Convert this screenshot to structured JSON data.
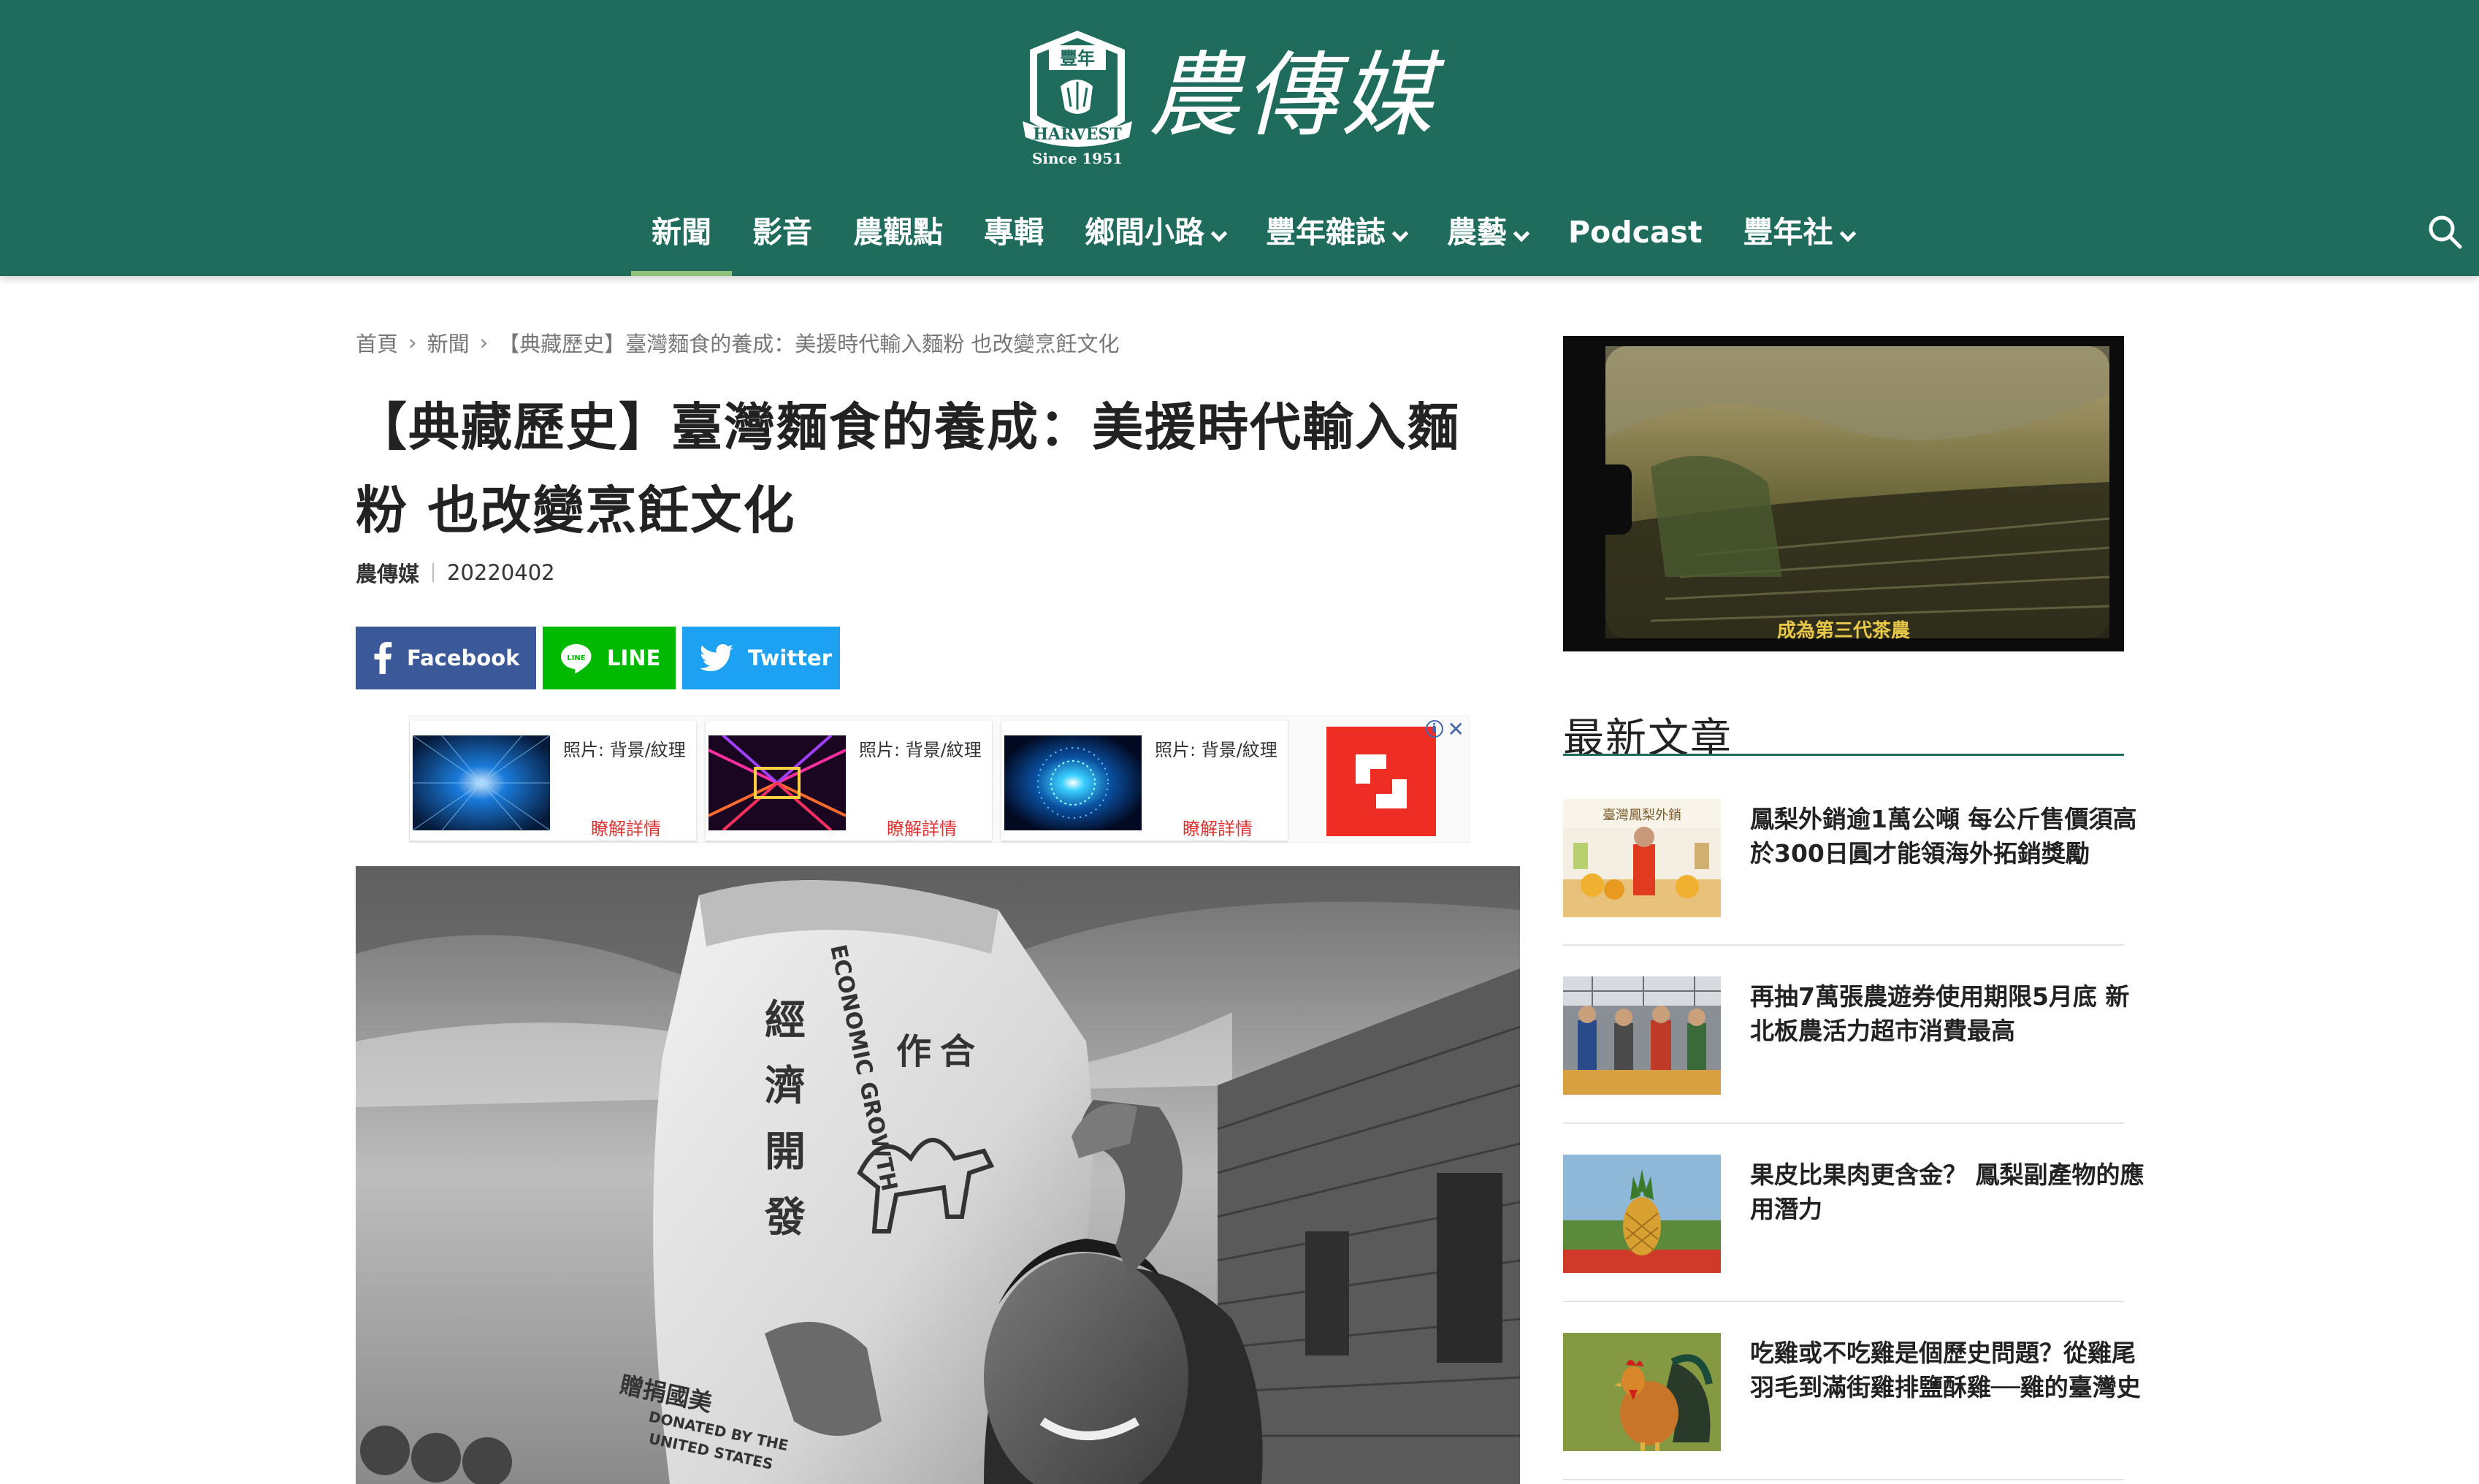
{
  "brand": {
    "emblem_top": "豐年",
    "emblem_band": "HARVEST",
    "emblem_since": "Since 1951",
    "name": "農傳媒"
  },
  "nav": {
    "items": [
      {
        "label": "新聞",
        "active": true,
        "dropdown": false
      },
      {
        "label": "影音",
        "active": false,
        "dropdown": false
      },
      {
        "label": "農觀點",
        "active": false,
        "dropdown": false
      },
      {
        "label": "專輯",
        "active": false,
        "dropdown": false
      },
      {
        "label": "鄉間小路",
        "active": false,
        "dropdown": true
      },
      {
        "label": "豐年雜誌",
        "active": false,
        "dropdown": true
      },
      {
        "label": "農藝",
        "active": false,
        "dropdown": true
      },
      {
        "label": "Podcast",
        "active": false,
        "dropdown": false
      },
      {
        "label": "豐年社",
        "active": false,
        "dropdown": true
      }
    ],
    "search_icon": "search-icon"
  },
  "breadcrumb": {
    "home": "首頁",
    "section": "新聞",
    "current": "【典藏歷史】臺灣麵食的養成：美援時代輸入麵粉 也改變烹飪文化",
    "separator": "›"
  },
  "article": {
    "title": "【典藏歷史】臺灣麵食的養成：美援時代輸入麵粉 也改變烹飪文化",
    "author": "農傳媒",
    "date": "20220402"
  },
  "share": {
    "facebook": "Facebook",
    "line": "LINE",
    "twitter": "Twitter"
  },
  "ad": {
    "cards": [
      {
        "label": "照片: 背景/紋理",
        "more": "瞭解詳情"
      },
      {
        "label": "照片: 背景/紋理",
        "more": "瞭解詳情"
      },
      {
        "label": "照片: 背景/紋理",
        "more": "瞭解詳情"
      }
    ],
    "info": "i",
    "close": "✕"
  },
  "hero": {
    "bag_text": [
      "經",
      "濟",
      "開",
      "發",
      "作",
      "合",
      "ECONOMIC GROWTH",
      "DONATED BY THE",
      "UNITED STATES",
      "贈捐國美"
    ]
  },
  "video": {
    "subtitle": "成為第三代茶農"
  },
  "sidebar": {
    "heading": "最新文章",
    "latest": [
      {
        "title": "鳳梨外銷逾1萬公噸 每公斤售價須高於300日圓才能領海外拓銷獎勵",
        "thumb_text": "臺灣鳳梨外銷"
      },
      {
        "title": "再抽7萬張農遊券使用期限5月底 新北板農活力超市消費最高",
        "thumb_text": ""
      },
      {
        "title": "果皮比果肉更含金？ 鳳梨副產物的應用潛力",
        "thumb_text": ""
      },
      {
        "title": "吃雞或不吃雞是個歷史問題？從雞尾羽毛到滿街雞排鹽酥雞──雞的臺灣史",
        "thumb_text": ""
      }
    ]
  },
  "colors": {
    "header_bg": "#1f6b5c",
    "nav_active_underline": "#8fc27a",
    "facebook": "#3b5998",
    "line": "#00b900",
    "twitter": "#1da1f2",
    "ad_link": "#dd3333",
    "shutterstock": "#ee2d24"
  }
}
